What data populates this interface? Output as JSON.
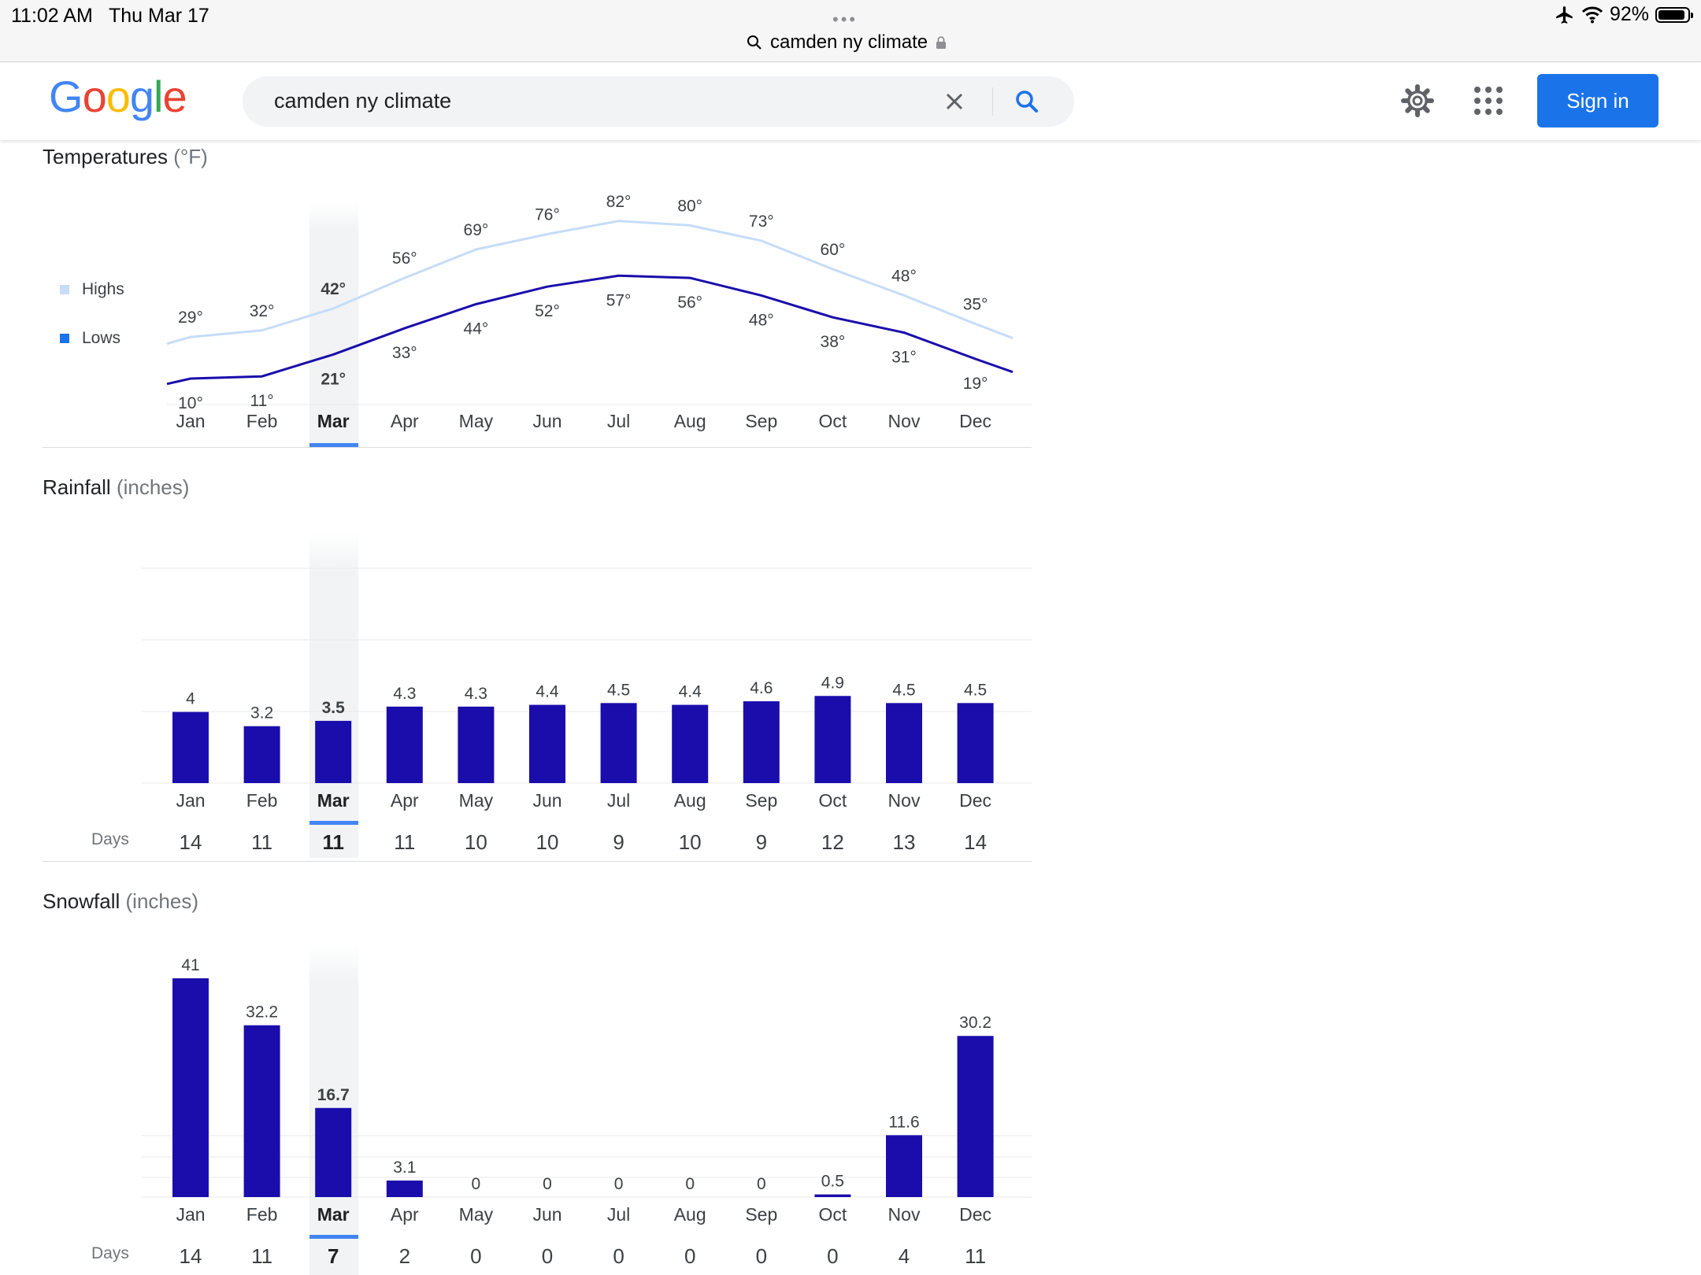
{
  "status_bar": {
    "time": "11:02 AM",
    "date": "Thu Mar 17",
    "url": "camden ny climate",
    "battery": "92%",
    "battery_level": 0.92
  },
  "header": {
    "search_query": "camden ny climate",
    "sign_in_label": "Sign in"
  },
  "colors": {
    "highs": "#c6dcf8",
    "lows": "#1a0dab",
    "bar": "#1a0dab",
    "highlight": "#4285f4",
    "brand_blue": "#1a73e8"
  },
  "months": [
    "Jan",
    "Feb",
    "Mar",
    "Apr",
    "May",
    "Jun",
    "Jul",
    "Aug",
    "Sep",
    "Oct",
    "Nov",
    "Dec"
  ],
  "selected_month_index": 2,
  "temperatures": {
    "title": "Temperatures",
    "unit": "(°F)",
    "legend": {
      "highs": "Highs",
      "lows": "Lows"
    }
  },
  "rainfall": {
    "title": "Rainfall",
    "unit": "(inches)",
    "days_label": "Days",
    "days": [
      14,
      11,
      11,
      11,
      10,
      10,
      9,
      10,
      9,
      12,
      13,
      14
    ]
  },
  "snowfall": {
    "title": "Snowfall",
    "unit": "(inches)",
    "days_label": "Days",
    "days": [
      14,
      11,
      7,
      2,
      0,
      0,
      0,
      0,
      0,
      0,
      4,
      11
    ]
  },
  "chart_data": [
    {
      "type": "line",
      "title": "Temperatures",
      "ylabel": "°F",
      "categories": [
        "Jan",
        "Feb",
        "Mar",
        "Apr",
        "May",
        "Jun",
        "Jul",
        "Aug",
        "Sep",
        "Oct",
        "Nov",
        "Dec"
      ],
      "series": [
        {
          "name": "Highs",
          "values": [
            29,
            32,
            42,
            56,
            69,
            76,
            82,
            80,
            73,
            60,
            48,
            35
          ]
        },
        {
          "name": "Lows",
          "values": [
            10,
            11,
            21,
            33,
            44,
            52,
            57,
            56,
            48,
            38,
            31,
            19
          ]
        }
      ],
      "legend": "left"
    },
    {
      "type": "bar",
      "title": "Rainfall",
      "ylabel": "inches",
      "categories": [
        "Jan",
        "Feb",
        "Mar",
        "Apr",
        "May",
        "Jun",
        "Jul",
        "Aug",
        "Sep",
        "Oct",
        "Nov",
        "Dec"
      ],
      "values": [
        4,
        3.2,
        3.5,
        4.3,
        4.3,
        4.4,
        4.5,
        4.4,
        4.6,
        4.9,
        4.5,
        4.5
      ],
      "ylim": [
        0,
        12
      ],
      "grid": true
    },
    {
      "type": "bar",
      "title": "Snowfall",
      "ylabel": "inches",
      "categories": [
        "Jan",
        "Feb",
        "Mar",
        "Apr",
        "May",
        "Jun",
        "Jul",
        "Aug",
        "Sep",
        "Oct",
        "Nov",
        "Dec"
      ],
      "values": [
        41,
        32.2,
        16.7,
        3.1,
        0,
        0,
        0,
        0,
        0,
        0.5,
        11.6,
        30.2
      ],
      "ylim": [
        0,
        41
      ],
      "grid": true
    }
  ]
}
